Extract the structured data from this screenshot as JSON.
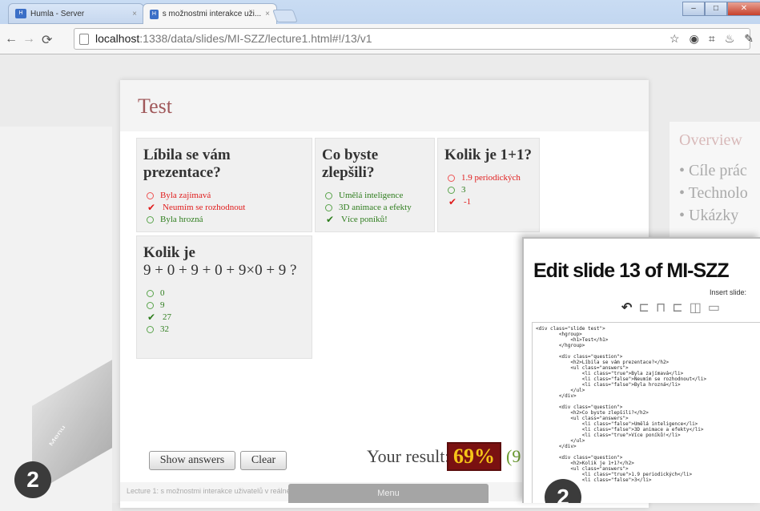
{
  "browser": {
    "tabs": [
      {
        "label": "Humla - Server"
      },
      {
        "label": "s možnostmi interakce uži..."
      }
    ],
    "url_host": "localhost",
    "url_path": ":1338/data/slides/MI-SZZ/lecture1.html#!/13/v1"
  },
  "slide": {
    "title": "Test",
    "questions": [
      {
        "title": "Líbila se vám prezentace?",
        "answers": [
          {
            "label": "Byla zajímavá",
            "state": "correct"
          },
          {
            "label": "Neumím se rozhodnout",
            "state": "wrong-checked"
          },
          {
            "label": "Byla hrozná",
            "state": "neutral"
          }
        ]
      },
      {
        "title": "Co byste zlepšili?",
        "answers": [
          {
            "label": "Umělá inteligence",
            "state": "neutral"
          },
          {
            "label": "3D animace a efekty",
            "state": "neutral"
          },
          {
            "label": "Více poníků!",
            "state": "correct-checked"
          }
        ]
      },
      {
        "title": "Kolik je 1+1?",
        "answers": [
          {
            "label": "1.9 periodických",
            "state": "wrong"
          },
          {
            "label": "3",
            "state": "neutral"
          },
          {
            "label": "-1",
            "state": "wrong-checked"
          }
        ]
      },
      {
        "title_line1": "Kolik je",
        "title_line2": "9 + 0 + 9 + 0 + 9×0 + 9 ?",
        "answers": [
          {
            "label": "0",
            "state": "neutral"
          },
          {
            "label": "9",
            "state": "neutral"
          },
          {
            "label": "27",
            "state": "correct-checked"
          },
          {
            "label": "32",
            "state": "neutral"
          }
        ]
      }
    ],
    "show_answers_label": "Show answers",
    "clear_label": "Clear",
    "result_label": "Your result:",
    "result_value": "69%",
    "result_extra": "(9",
    "footer": "Lecture 1: s možnostmi interakce uživatelů v reálném čase, CTU Writer Semester 2011/2012, mikulas@fit",
    "menu_label": "Menu"
  },
  "overview": {
    "title": "Overview",
    "items": [
      "Cíle prác",
      "Technolo",
      "Ukázky"
    ]
  },
  "editor": {
    "title": "Edit slide 13 of MI-SZZ",
    "insert_label": "Insert slide:",
    "code": "<div class=\"slide test\">\n        <hgroup>\n            <h1>Test</h1>\n        </hgroup>\n\n        <div class=\"question\">\n            <h2>Líbila se vám prezentace?</h2>\n            <ul class=\"answers\">\n                <li class=\"true\">Byla zajímavá</li>\n                <li class=\"false\">Neumím se rozhodnout</li>\n                <li class=\"false\">Byla hrozná</li>\n            </ul>\n        </div>\n\n        <div class=\"question\">\n            <h2>Co byste zlepšili?</h2>\n            <ul class=\"answers\">\n                <li class=\"false\">Umělá inteligence</li>\n                <li class=\"false\">3D animace a efekty</li>\n                <li class=\"true\">Více poníků!</li>\n            </ul>\n        </div>\n\n        <div class=\"question\">\n            <h2>Kolik je 1+1?</h2>\n            <ul class=\"answers\">\n                <li class=\"true\">1.9 periodických</li>\n                <li class=\"false\">3</li>"
  },
  "decor": {
    "left_menu_label": "Menu",
    "badge_left": "2",
    "badge_editor": "2"
  }
}
